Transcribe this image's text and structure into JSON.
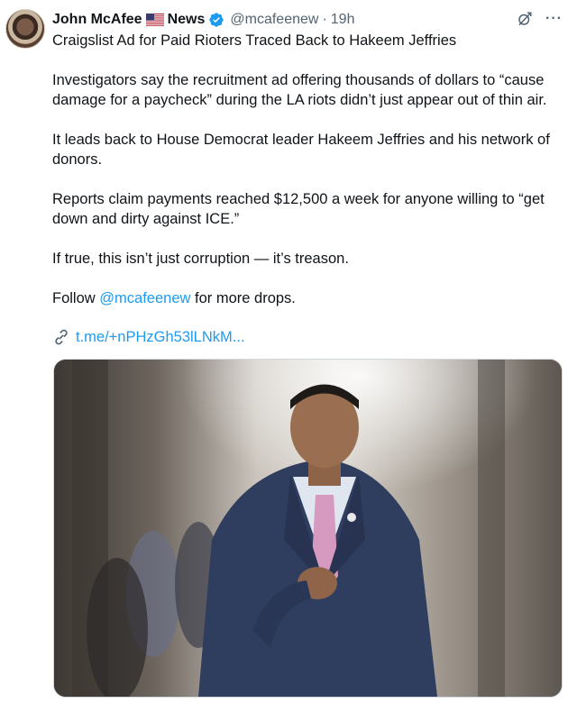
{
  "author": {
    "display_name": "John McAfee",
    "flag_icon": "us-flag-icon",
    "name_suffix": "News",
    "verified_color": "#1d9bf0",
    "handle": "@mcafeenew",
    "separator": "·",
    "time": "19h"
  },
  "post": {
    "title": "Craigslist Ad for Paid Rioters Traced Back to Hakeem Jeffries",
    "paragraphs": [
      "Investigators say the recruitment ad offering thousands of dollars to “cause damage for a paycheck” during the LA riots didn’t just appear out of thin air.",
      "It leads back to House Democrat leader Hakeem Jeffries and his network of donors.",
      "Reports claim payments reached $12,500 a week for anyone willing to “get down and dirty against ICE.”",
      "If true, this isn’t just corruption — it’s treason."
    ],
    "follow_prefix": "Follow",
    "follow_mention": "@mcafeenew",
    "follow_suffix": "for more drops.",
    "link_text": "t.me/+nPHzGh53lLNkM..."
  },
  "icons": {
    "grok": "grok-icon",
    "more": "more-icon",
    "link": "link-icon"
  },
  "colors": {
    "accent": "#1d9bf0",
    "secondary_text": "#536471"
  }
}
